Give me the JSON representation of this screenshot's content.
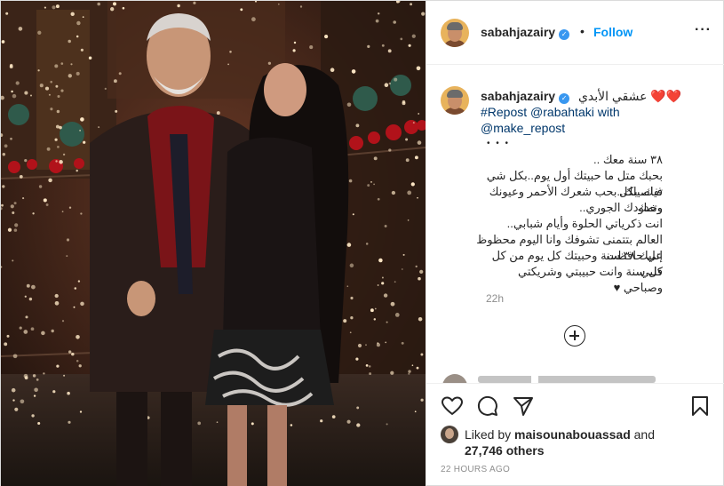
{
  "post": {
    "username": "sabahjazairy",
    "follow_label": "Follow",
    "separator": "•",
    "more_icon": "more-horizontal-icon"
  },
  "caption": {
    "username": "sabahjazairy",
    "title_ar": "عشقي الأبدي ❤️❤️",
    "repost_line": "#Repost @rabahtaki with",
    "make_repost": "@make_repost",
    "dots": "• • •",
    "lines_ar": [
      "٣٨ سنة معك ..",
      "بحبك متل ما حبيتك أول يوم..بكل شي فيك..بكل",
      "تفاصيلك..بحب شعرك الأحمر وعيونك وتمك",
      "وخدودك الجوري..",
      "انت ذكرياتي الحلوة وأيام شبابي..",
      "العالم بتتمنى تشوفك وانا اليوم محظوظ إني حافظت",
      "عليك ٣٨ سنة وحبيتك كل يوم من كل قلبي..",
      "كل سنة وانت حبيبتي وشريكتي وصباحي ♥"
    ],
    "time": "22h"
  },
  "actions": {
    "like_icon": "heart-icon",
    "comment_icon": "comment-icon",
    "share_icon": "share-icon",
    "save_icon": "bookmark-icon"
  },
  "likes": {
    "prefix": "Liked by ",
    "user": "maisounabouassad",
    "and": " and",
    "count": "27,746 others"
  },
  "posted": "22 HOURS AGO",
  "colors": {
    "link_blue": "#0095f6",
    "hashtag": "#00376b",
    "muted": "#8e8e8e",
    "verified": "#3897f0"
  }
}
